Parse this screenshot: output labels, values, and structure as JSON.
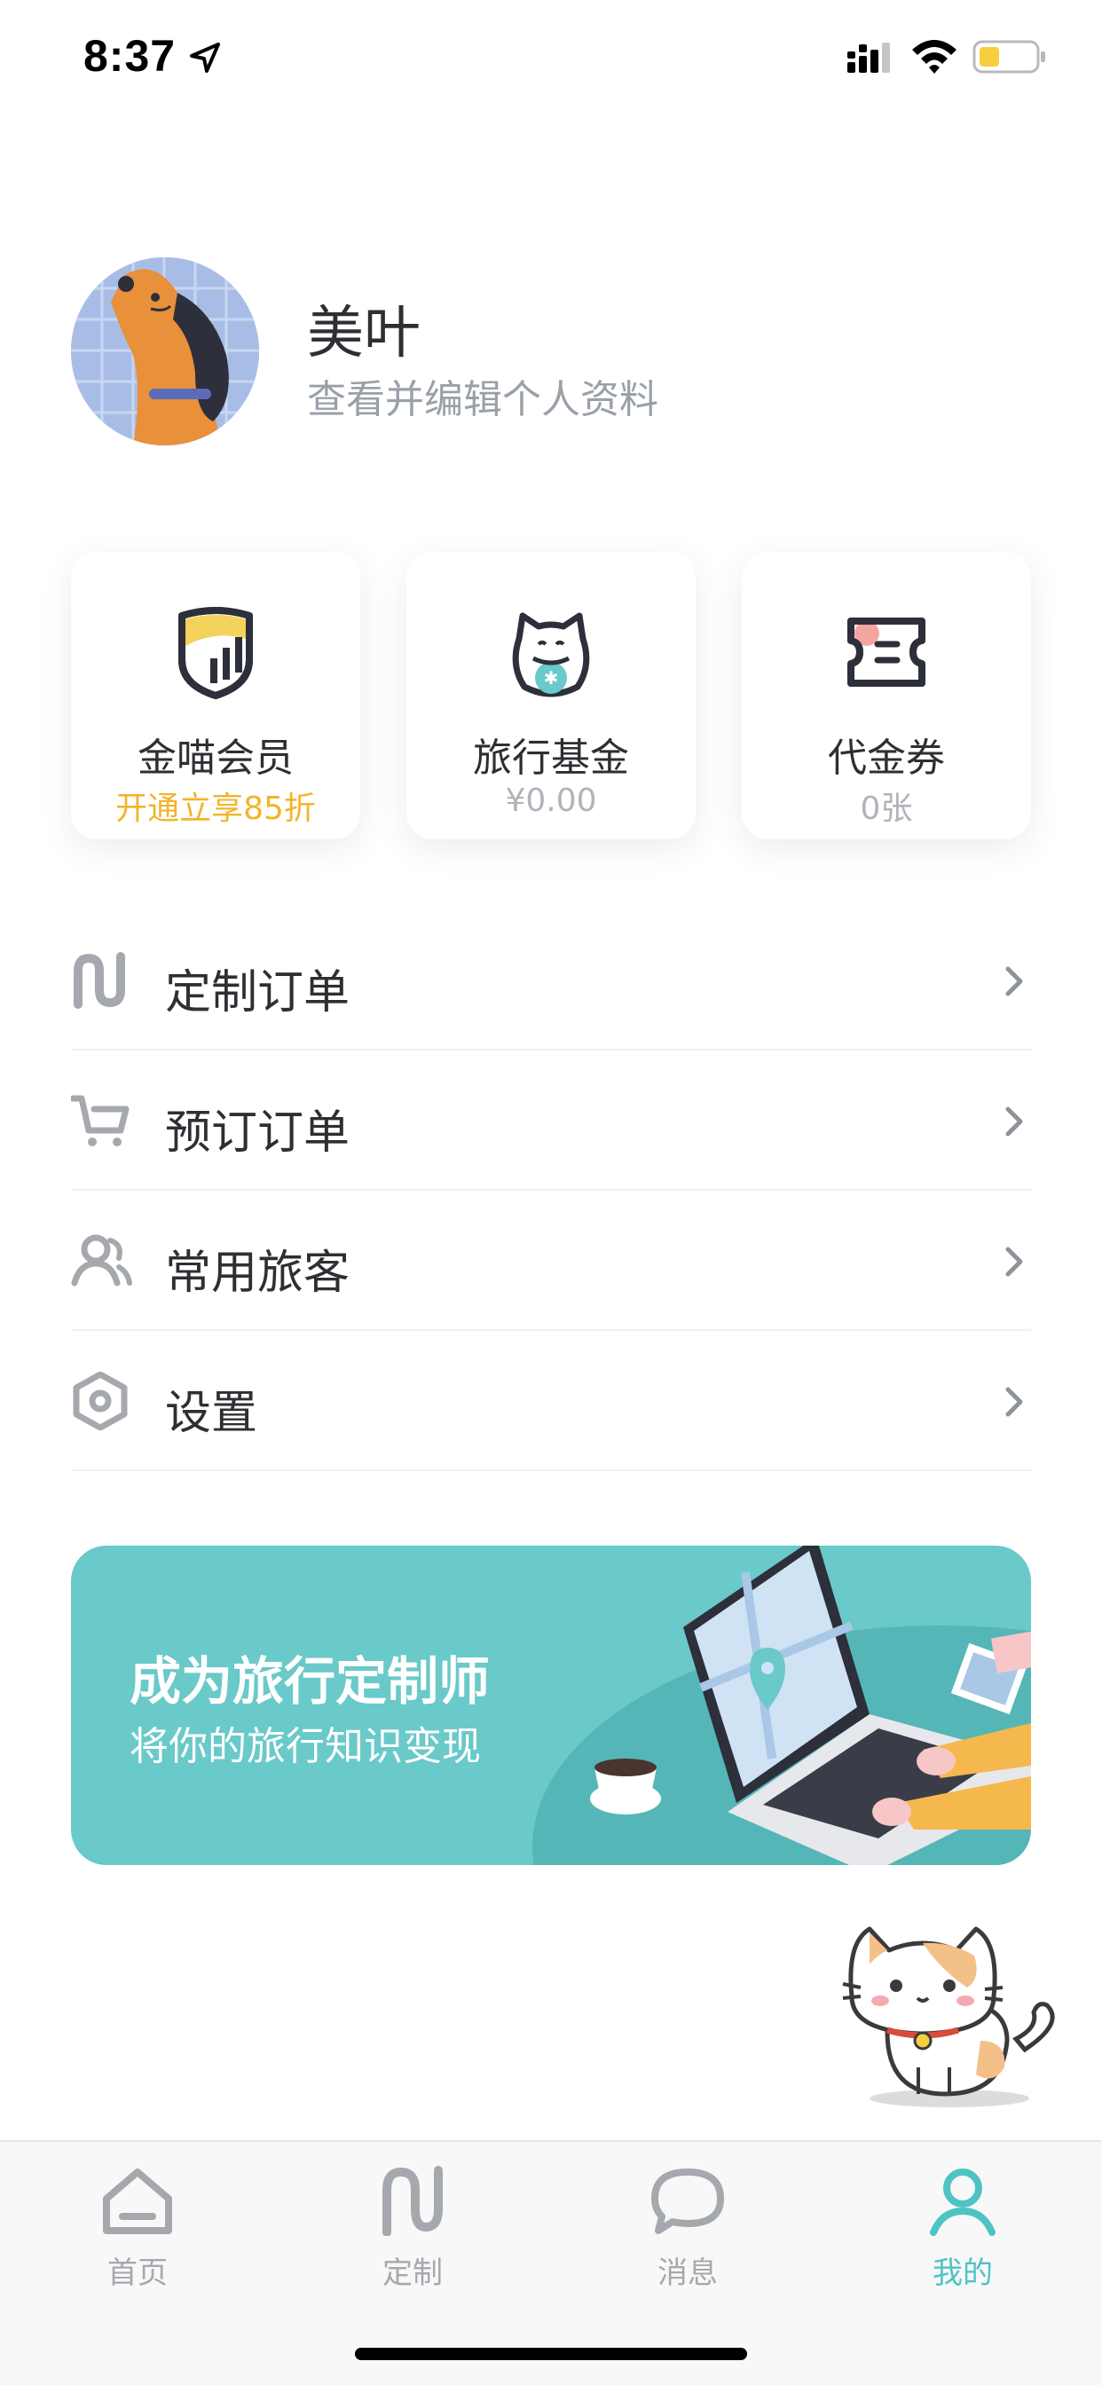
{
  "status_bar": {
    "time": "8:37"
  },
  "profile": {
    "name": "美叶",
    "subtitle": "查看并编辑个人资料"
  },
  "cards": [
    {
      "title": "金喵会员",
      "subtitle": "开通立享85折",
      "icon": "shield-member-icon"
    },
    {
      "title": "旅行基金",
      "subtitle": "¥0.00",
      "icon": "lucky-cat-icon"
    },
    {
      "title": "代金券",
      "subtitle": "0张",
      "icon": "ticket-icon"
    }
  ],
  "menu": [
    {
      "label": "定制订单",
      "icon": "custom-order-icon"
    },
    {
      "label": "预订订单",
      "icon": "cart-icon"
    },
    {
      "label": "常用旅客",
      "icon": "travelers-icon"
    },
    {
      "label": "设置",
      "icon": "settings-hex-icon"
    }
  ],
  "banner": {
    "title": "成为旅行定制师",
    "subtitle": "将你的旅行知识变现"
  },
  "tabs": [
    {
      "label": "首页",
      "icon": "home-icon"
    },
    {
      "label": "定制",
      "icon": "custom-icon"
    },
    {
      "label": "消息",
      "icon": "message-icon"
    },
    {
      "label": "我的",
      "icon": "profile-icon",
      "active": true
    }
  ],
  "colors": {
    "accent": "#4ec3c4",
    "gold": "#f3b42b",
    "banner_bg": "#6ac9c9",
    "icon_gray": "#a5a9ae"
  }
}
